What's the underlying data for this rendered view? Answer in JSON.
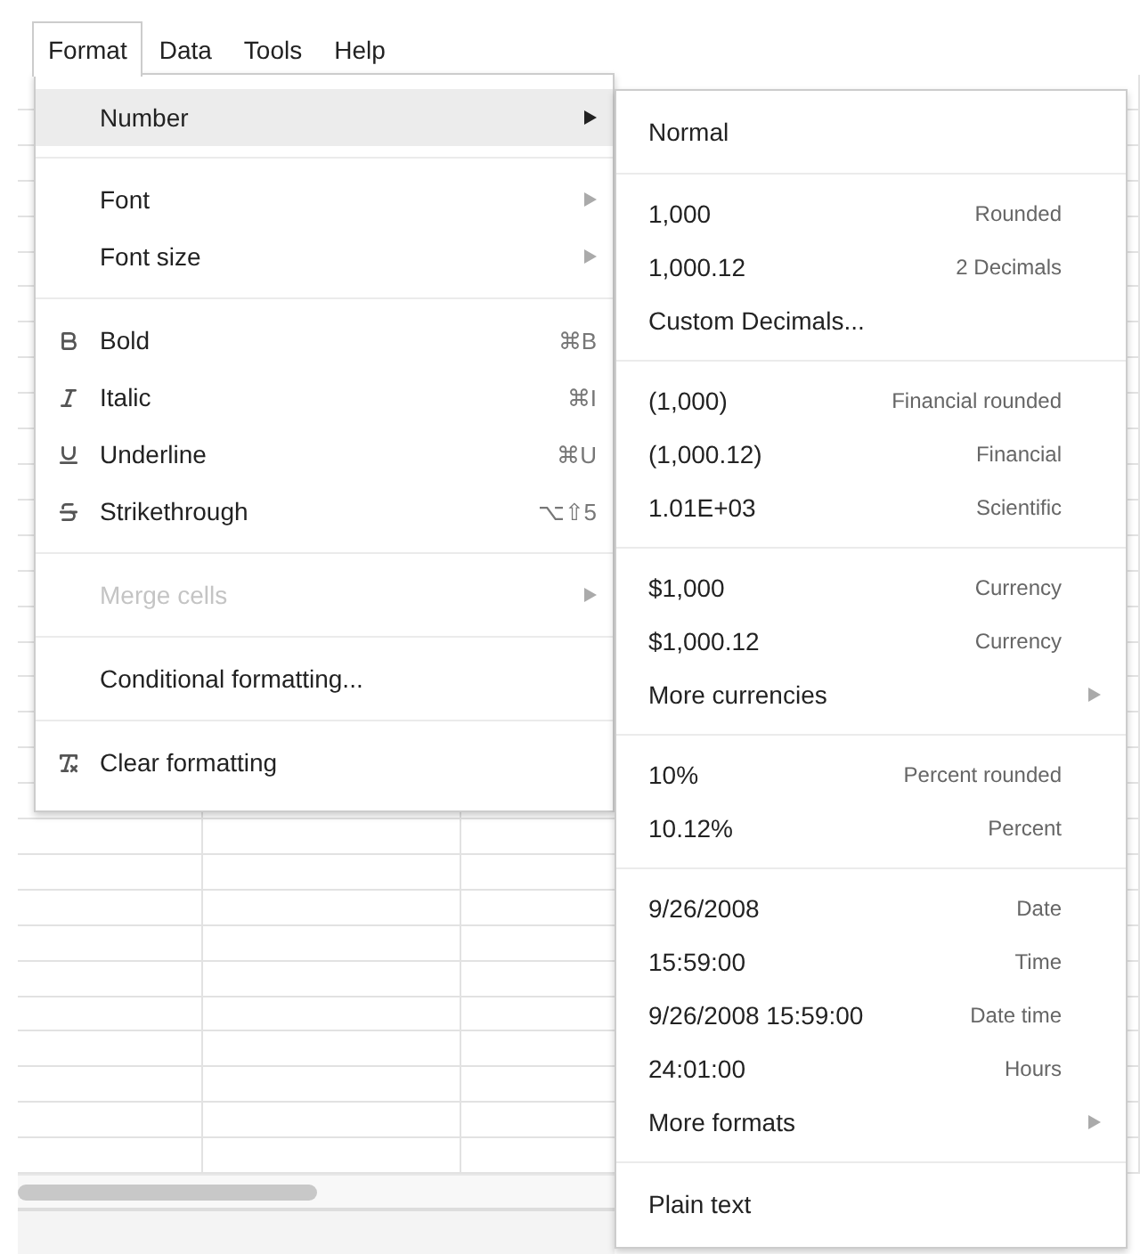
{
  "menubar": [
    {
      "label": "Format",
      "selected": true
    },
    {
      "label": "Data",
      "selected": false
    },
    {
      "label": "Tools",
      "selected": false
    },
    {
      "label": "Help",
      "selected": false
    }
  ],
  "format_menu": {
    "sections": [
      [
        {
          "label": "Number",
          "kind": "plain",
          "submenu": true,
          "selected": true,
          "disabled": false
        }
      ],
      [
        {
          "label": "Font",
          "kind": "plain",
          "submenu": true,
          "selected": false,
          "disabled": false
        },
        {
          "label": "Font size",
          "kind": "plain",
          "submenu": true,
          "selected": false,
          "disabled": false
        }
      ],
      [
        {
          "label": "Bold",
          "kind": "bold",
          "shortcut": "⌘B",
          "selected": false,
          "disabled": false
        },
        {
          "label": "Italic",
          "kind": "italic",
          "shortcut": "⌘I",
          "selected": false,
          "disabled": false
        },
        {
          "label": "Underline",
          "kind": "underline",
          "shortcut": "⌘U",
          "selected": false,
          "disabled": false
        },
        {
          "label": "Strikethrough",
          "kind": "strikethrough",
          "shortcut": "⌥⇧5",
          "selected": false,
          "disabled": false
        }
      ],
      [
        {
          "label": "Merge cells",
          "kind": "plain",
          "submenu": true,
          "selected": false,
          "disabled": true
        }
      ],
      [
        {
          "label": "Conditional formatting...",
          "kind": "plain",
          "selected": false,
          "disabled": false
        }
      ],
      [
        {
          "label": "Clear formatting",
          "kind": "clear",
          "selected": false,
          "disabled": false
        }
      ]
    ]
  },
  "number_submenu": {
    "sections": [
      [
        {
          "label": "Normal"
        }
      ],
      [
        {
          "label": "1,000",
          "hint": "Rounded"
        },
        {
          "label": "1,000.12",
          "hint": "2 Decimals"
        },
        {
          "label": "Custom Decimals..."
        }
      ],
      [
        {
          "label": "(1,000)",
          "hint": "Financial rounded"
        },
        {
          "label": "(1,000.12)",
          "hint": "Financial"
        },
        {
          "label": "1.01E+03",
          "hint": "Scientific"
        }
      ],
      [
        {
          "label": "$1,000",
          "hint": "Currency"
        },
        {
          "label": "$1,000.12",
          "hint": "Currency"
        },
        {
          "label": "More currencies",
          "submenu": true
        }
      ],
      [
        {
          "label": "10%",
          "hint": "Percent rounded"
        },
        {
          "label": "10.12%",
          "hint": "Percent"
        }
      ],
      [
        {
          "label": "9/26/2008",
          "hint": "Date"
        },
        {
          "label": "15:59:00",
          "hint": "Time"
        },
        {
          "label": "9/26/2008 15:59:00",
          "hint": "Date time"
        },
        {
          "label": "24:01:00",
          "hint": "Hours"
        },
        {
          "label": "More formats",
          "submenu": true
        }
      ],
      [
        {
          "label": "Plain text"
        }
      ]
    ]
  }
}
